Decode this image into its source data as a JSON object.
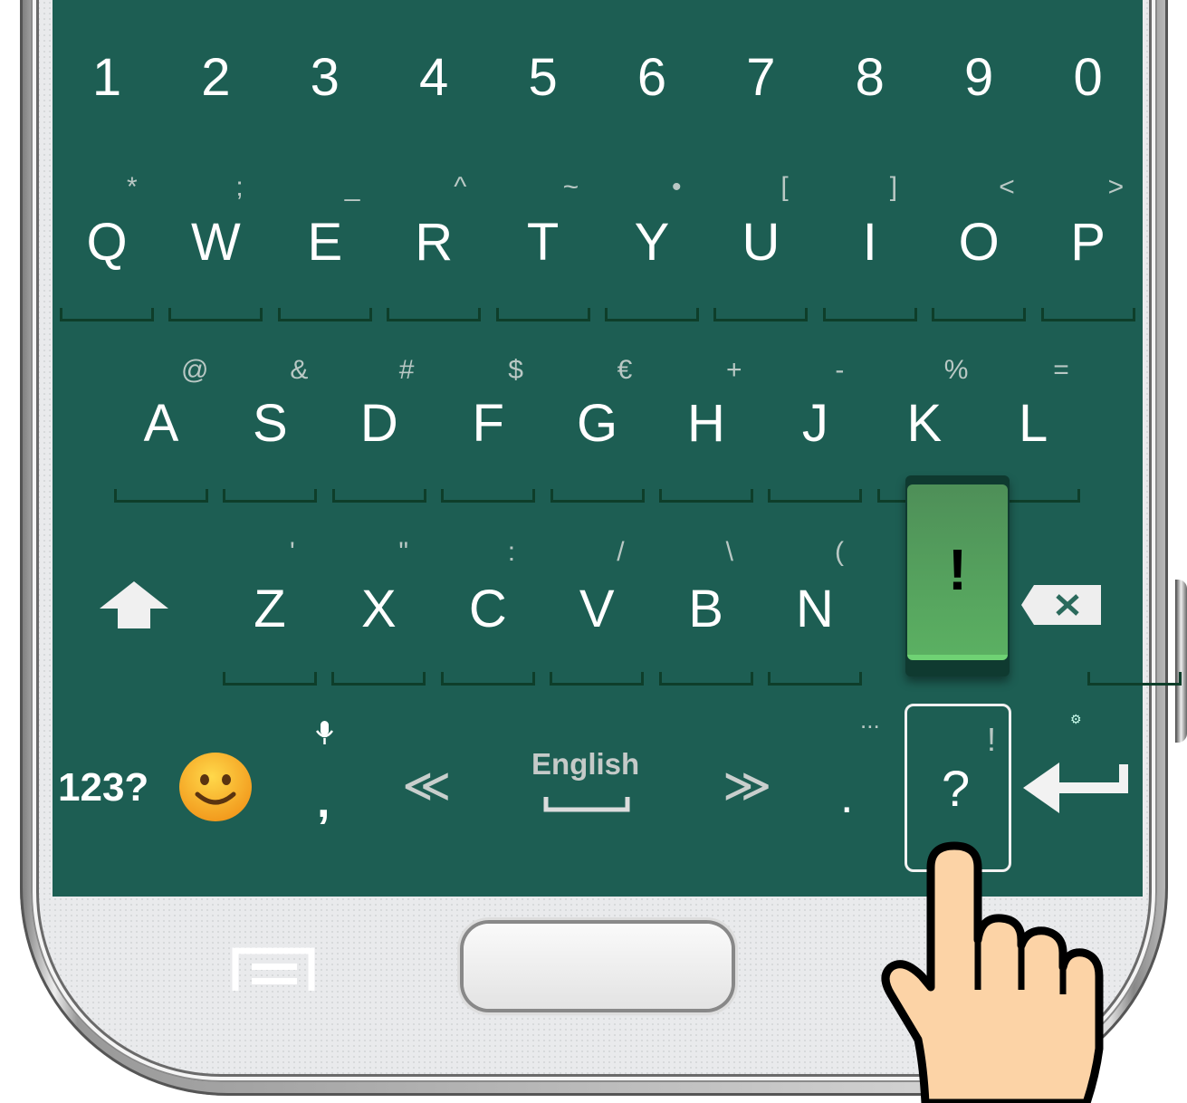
{
  "keyboard": {
    "background_color": "#1d5e53",
    "number_row": [
      "1",
      "2",
      "3",
      "4",
      "5",
      "6",
      "7",
      "8",
      "9",
      "0"
    ],
    "row1": [
      {
        "label": "Q",
        "hint": "*"
      },
      {
        "label": "W",
        "hint": ";"
      },
      {
        "label": "E",
        "hint": "_"
      },
      {
        "label": "R",
        "hint": "^"
      },
      {
        "label": "T",
        "hint": "~"
      },
      {
        "label": "Y",
        "hint": "•"
      },
      {
        "label": "U",
        "hint": "["
      },
      {
        "label": "I",
        "hint": "]"
      },
      {
        "label": "O",
        "hint": "<"
      },
      {
        "label": "P",
        "hint": ">"
      }
    ],
    "row2": [
      {
        "label": "A",
        "hint": "@"
      },
      {
        "label": "S",
        "hint": "&"
      },
      {
        "label": "D",
        "hint": "#"
      },
      {
        "label": "F",
        "hint": "$"
      },
      {
        "label": "G",
        "hint": "€"
      },
      {
        "label": "H",
        "hint": "+"
      },
      {
        "label": "J",
        "hint": "-"
      },
      {
        "label": "K",
        "hint": "%"
      },
      {
        "label": "L",
        "hint": "="
      }
    ],
    "row3": [
      {
        "label": "Z",
        "hint": "'"
      },
      {
        "label": "X",
        "hint": "\""
      },
      {
        "label": "C",
        "hint": ":"
      },
      {
        "label": "V",
        "hint": "/"
      },
      {
        "label": "B",
        "hint": "\\"
      },
      {
        "label": "N",
        "hint": "("
      }
    ],
    "popup": {
      "label": "!",
      "color": "#5bb062"
    },
    "bottom_row": {
      "symbols_label": "123?",
      "emoji": "🙂",
      "comma": ",",
      "mic_hint": "🎙",
      "prev_label": "≪",
      "language_label": "English",
      "next_label": "≫",
      "period": ".",
      "period_hint": "...",
      "question": "?",
      "question_hint": "!",
      "settings_hint": "⚙"
    },
    "icons": {
      "shift": "shift-icon",
      "backspace": "backspace-icon",
      "enter": "enter-icon"
    }
  },
  "device": {
    "menu_icon": "menu-icon",
    "home_button": "home-button",
    "back_icon": "back-icon"
  },
  "overlay": {
    "hand": "pointing-hand-icon"
  }
}
